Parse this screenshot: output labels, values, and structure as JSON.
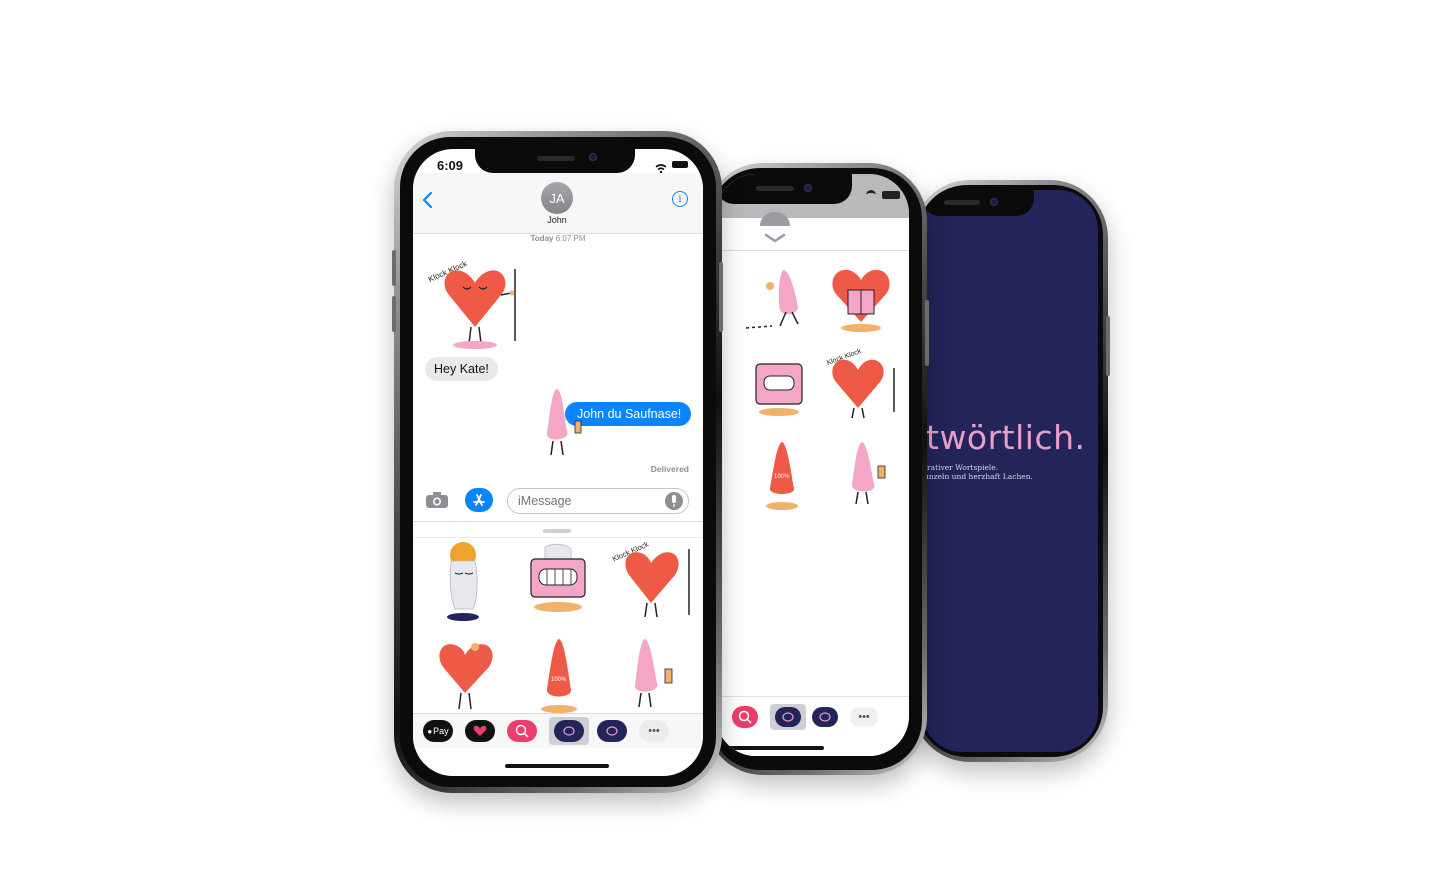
{
  "phone1": {
    "status": {
      "time": "6:09"
    },
    "header": {
      "back": "<",
      "avatar_initials": "JA",
      "contact_name": "John",
      "info": "i"
    },
    "thread": {
      "timestamp_day": "Today",
      "timestamp_time": "6:07 PM",
      "received_bubble": "Hey Kate!",
      "sent_bubble": "John du Saufnase!",
      "sticker_text": "Klock Klock",
      "delivered": "Delivered"
    },
    "input": {
      "placeholder": "iMessage"
    },
    "drawer_stickers": {
      "heart_text": "Klock Klock",
      "badge": "100%"
    },
    "app_drawer": {
      "apple_pay_label": "Pay",
      "more": "•••"
    }
  },
  "phone2": {
    "sticker_text": "Klock Klock",
    "badge": "100%",
    "more": "•••"
  },
  "phone3": {
    "wordmark": "twörtlich.",
    "line1": "trativer Wortspiele.",
    "line2": "unzeln und herzhaft Lachen."
  },
  "colors": {
    "imessage_blue": "#0b84ff",
    "received_gray": "#e9e9eb",
    "sticker_red": "#ef5a47",
    "sticker_pink": "#f3a6c6",
    "navy": "#22245a",
    "wordmark_pink": "#e9a0c8"
  }
}
